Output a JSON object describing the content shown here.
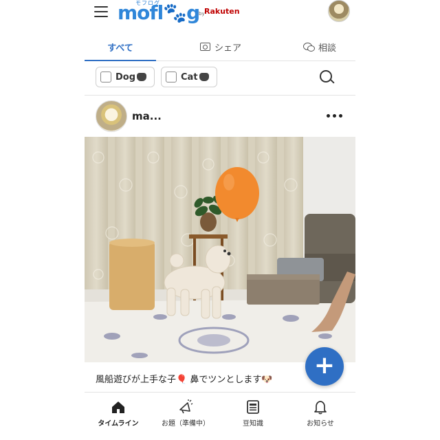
{
  "header": {
    "menu_icon": "hamburger-menu-icon",
    "logo_text": "mofl",
    "logo_text_tail": "g",
    "logo_kana": "モフログ",
    "logo_by": "by",
    "logo_brand": "Rakuten"
  },
  "tabs": [
    {
      "label": "すべて",
      "active": true,
      "icon": ""
    },
    {
      "label": "シェア",
      "active": false,
      "icon": "camera-icon"
    },
    {
      "label": "相談",
      "active": false,
      "icon": "chat-icon"
    }
  ],
  "filters": {
    "dog_label": "Dog",
    "cat_label": "Cat"
  },
  "post": {
    "user": "ma...",
    "caption": "風船遊びが上手な子🎈 鼻でツンとします🐶"
  },
  "fab_label": "+",
  "bottom_nav": [
    {
      "label": "タイムライン",
      "icon": "home-icon",
      "active": true
    },
    {
      "label": "お題（準備中）",
      "icon": "megaphone-icon",
      "active": false
    },
    {
      "label": "豆知識",
      "icon": "article-icon",
      "active": false
    },
    {
      "label": "お知らせ",
      "icon": "bell-icon",
      "active": false
    }
  ],
  "colors": {
    "accent": "#2f6fc4",
    "logo_blue": "#2f86d9",
    "rakuten_red": "#bf0000",
    "balloon": "#f28a2e"
  }
}
